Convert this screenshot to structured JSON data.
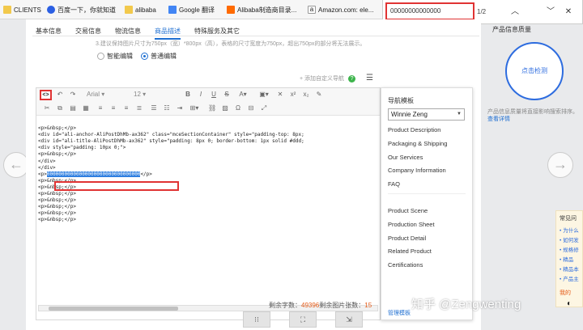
{
  "bookmarks": [
    {
      "label": "CLIENTS",
      "icon": "folder-icon",
      "color": "#f2c94c"
    },
    {
      "label": "百度一下，你就知道",
      "icon": "baidu-paw-icon",
      "color": "#2b5fe3"
    },
    {
      "label": "alibaba",
      "icon": "folder-icon",
      "color": "#f2c94c"
    },
    {
      "label": "Google 翻译",
      "icon": "google-translate-icon",
      "color": "#4285f4"
    },
    {
      "label": "Alibaba制造商目录...",
      "icon": "alibaba-icon",
      "color": "#ff6a00"
    },
    {
      "label": "Amazon.com: ele...",
      "icon": "amazon-icon",
      "color": "#222222"
    }
  ],
  "find_bar": {
    "value": "00000000000000",
    "count": "1/2",
    "prev_icon": "chevron-up-icon",
    "next_icon": "chevron-down-icon",
    "close_icon": "close-icon"
  },
  "tabs": [
    "基本信息",
    "交易信息",
    "物流信息",
    "商品描述",
    "特殊服务及其它"
  ],
  "active_tab": "商品描述",
  "hint_text": "3.建议保持图片尺寸为750px（宽）*800px（高），表格的尺寸宽度为750px，超出750px的部分将无法展示。",
  "editor_modes": {
    "smart": "智能编辑",
    "normal": "普通编辑",
    "selected": "normal"
  },
  "custom_nav_label": "+ 添加自定义导航",
  "toolbar": {
    "code_label": "<>",
    "font_family": "Arial",
    "font_size": "12"
  },
  "code_lines": [
    "<p>&nbsp;</p>",
    "<div id=\"ali-anchor-AliPostDhMb-ax362\" class=\"mceSectionContainer\" style=\"padding-top: 8px;",
    "<div id=\"ali-title-AliPostDhMb-ax362\" style=\"padding: 8px 0; border-bottom: 1px solid #ddd;",
    "<div style=\"padding: 10px 0;\">",
    "<p>&nbsp;</p>",
    "</div>",
    "</div>",
    "<p>",
    "<p>&nbsp;</p>",
    "<p>&nbsp;</p>",
    "<p>&nbsp;</p>",
    "<p>&nbsp;</p>",
    "<p>&nbsp;</p>",
    "<p>&nbsp;</p>",
    "<p>&nbsp;</p>"
  ],
  "highlighted_text": "00000000000000000000000000000000",
  "highlighted_suffix": "</p>",
  "counter": {
    "chars_label": "剩余字数：",
    "chars_value": "49396",
    "images_label": "剩余图片张数：",
    "images_value": "15"
  },
  "nav_panel": {
    "title": "导航模板",
    "selected_template": "Winnie Zeng",
    "items_group1": [
      "Product Description",
      "Packaging & Shipping",
      "Our Services",
      "Company Information",
      "FAQ"
    ],
    "items_group2": [
      "Product Scene",
      "Production Sheet",
      "Product Detail",
      "Related Product",
      "Certifications"
    ],
    "manage_label": "管理模板"
  },
  "bottom_buttons": [
    "⁝⁝",
    "⛶",
    "⇲"
  ],
  "right_panel": {
    "title": "产品信息质量",
    "check_button": "点击检测",
    "desc": "产品信息质量将直接影响搜索排序。",
    "desc_link": "查看详情",
    "faq_title": "常见问",
    "faq_items": [
      "为什么",
      "如何发",
      "规格修",
      "精品",
      "精品本",
      "产品主"
    ],
    "faq_more": "我的"
  },
  "watermark": "知乎 @Zengwenting",
  "accent_color": "#1f6fd1",
  "highlight_color": "#e03333"
}
